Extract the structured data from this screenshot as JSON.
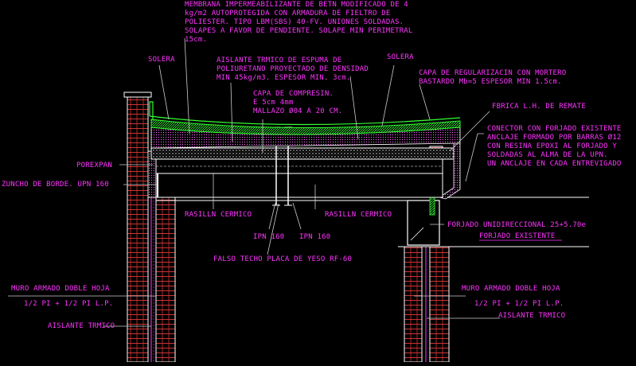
{
  "colors": {
    "background": "#000000",
    "annotation": "#ff33ff",
    "structure": "#ffffff",
    "waterproofing": "#33ff33",
    "brick": "#cc3333",
    "leader": "#cccccc"
  },
  "labels": {
    "membrana": [
      "MEMBRANA IMPERMEABILIZANTE DE BETN MODIFICADO DE 4",
      "kg/m2  AUTOPROTEGIDA CON ARMADURA DE  FIELTRO DE",
      "POLIESTER. TIPO LBM(SBS) 40-FV. UNIONES SOLDADAS.",
      "SOLAPES A FAVOR DE PENDIENTE. SOLAPE MIN PERIMETRAL",
      "15cm."
    ],
    "solera_left": "SOLERA",
    "solera_right": "SOLERA",
    "aislante_top": [
      "AISLANTE TRMICO DE ESPUMA DE",
      "POLIURETANO PROYECTADO DE DENSIDAD",
      "MIN 45kg/m3. ESPESOR MIN. 3cm."
    ],
    "capa_regularizacion": [
      "CAPA DE REGULARIZACIN CON MORTERO",
      "BASTARDO Mb=5  ESPESOR MIN 1.5cm."
    ],
    "capa_compresion": [
      "CAPA DE COMPRESIN.",
      "E  5cm   4mm",
      "MALLAZO Ø04 A 20 CM."
    ],
    "fabrica_remate": "FBRICA L.H. DE REMATE",
    "conector": [
      "CONECTOR CON FORJADO EXISTENTE",
      "ANCLAJE FORMADO POR BARRAS Ø12",
      "CON RESINA EPOXI AL FORJADO Y",
      "SOLDADAS AL ALMA DE LA UPN.",
      "UN ANCLAJE EN CADA ENTREVIGADO"
    ],
    "porexpan": "POREXPAN",
    "zuncho": "ZUNCHO DE BORDE. UPN 160",
    "rasillon_left": "RASILLN CERMICO",
    "rasillon_right": "RASILLN CERMICO",
    "ipn_left": "IPN 160",
    "ipn_right": "IPN 160",
    "forjado_unidireccional": "FORJADO UNIDIRECCIONAL 25+5.70e",
    "forjado_existente": "FORJADO EXISTENTE",
    "falso_techo": "FALSO TECHO PLACA DE YESO RF-60",
    "muro_left": [
      "MURO ARMADO DOBLE HOJA",
      "1/2 PI + 1/2 PI L.P."
    ],
    "muro_right": [
      "MURO ARMADO DOBLE HOJA",
      "1/2 PI + 1/2 PI L.P."
    ],
    "aislante_left": "AISLANTE TRMICO",
    "aislante_right": "AISLANTE TRMICO"
  }
}
